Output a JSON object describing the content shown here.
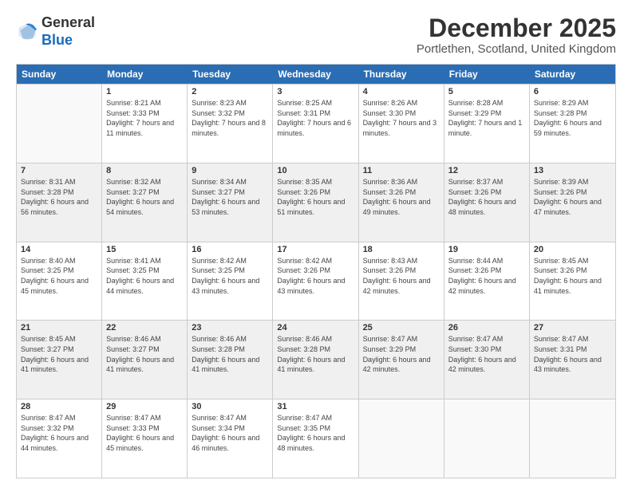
{
  "header": {
    "logo_general": "General",
    "logo_blue": "Blue",
    "month_year": "December 2025",
    "location": "Portlethen, Scotland, United Kingdom"
  },
  "weekdays": [
    "Sunday",
    "Monday",
    "Tuesday",
    "Wednesday",
    "Thursday",
    "Friday",
    "Saturday"
  ],
  "weeks": [
    [
      {
        "day": "",
        "sunrise": "",
        "sunset": "",
        "daylight": ""
      },
      {
        "day": "1",
        "sunrise": "Sunrise: 8:21 AM",
        "sunset": "Sunset: 3:33 PM",
        "daylight": "Daylight: 7 hours and 11 minutes."
      },
      {
        "day": "2",
        "sunrise": "Sunrise: 8:23 AM",
        "sunset": "Sunset: 3:32 PM",
        "daylight": "Daylight: 7 hours and 8 minutes."
      },
      {
        "day": "3",
        "sunrise": "Sunrise: 8:25 AM",
        "sunset": "Sunset: 3:31 PM",
        "daylight": "Daylight: 7 hours and 6 minutes."
      },
      {
        "day": "4",
        "sunrise": "Sunrise: 8:26 AM",
        "sunset": "Sunset: 3:30 PM",
        "daylight": "Daylight: 7 hours and 3 minutes."
      },
      {
        "day": "5",
        "sunrise": "Sunrise: 8:28 AM",
        "sunset": "Sunset: 3:29 PM",
        "daylight": "Daylight: 7 hours and 1 minute."
      },
      {
        "day": "6",
        "sunrise": "Sunrise: 8:29 AM",
        "sunset": "Sunset: 3:28 PM",
        "daylight": "Daylight: 6 hours and 59 minutes."
      }
    ],
    [
      {
        "day": "7",
        "sunrise": "Sunrise: 8:31 AM",
        "sunset": "Sunset: 3:28 PM",
        "daylight": "Daylight: 6 hours and 56 minutes."
      },
      {
        "day": "8",
        "sunrise": "Sunrise: 8:32 AM",
        "sunset": "Sunset: 3:27 PM",
        "daylight": "Daylight: 6 hours and 54 minutes."
      },
      {
        "day": "9",
        "sunrise": "Sunrise: 8:34 AM",
        "sunset": "Sunset: 3:27 PM",
        "daylight": "Daylight: 6 hours and 53 minutes."
      },
      {
        "day": "10",
        "sunrise": "Sunrise: 8:35 AM",
        "sunset": "Sunset: 3:26 PM",
        "daylight": "Daylight: 6 hours and 51 minutes."
      },
      {
        "day": "11",
        "sunrise": "Sunrise: 8:36 AM",
        "sunset": "Sunset: 3:26 PM",
        "daylight": "Daylight: 6 hours and 49 minutes."
      },
      {
        "day": "12",
        "sunrise": "Sunrise: 8:37 AM",
        "sunset": "Sunset: 3:26 PM",
        "daylight": "Daylight: 6 hours and 48 minutes."
      },
      {
        "day": "13",
        "sunrise": "Sunrise: 8:39 AM",
        "sunset": "Sunset: 3:26 PM",
        "daylight": "Daylight: 6 hours and 47 minutes."
      }
    ],
    [
      {
        "day": "14",
        "sunrise": "Sunrise: 8:40 AM",
        "sunset": "Sunset: 3:25 PM",
        "daylight": "Daylight: 6 hours and 45 minutes."
      },
      {
        "day": "15",
        "sunrise": "Sunrise: 8:41 AM",
        "sunset": "Sunset: 3:25 PM",
        "daylight": "Daylight: 6 hours and 44 minutes."
      },
      {
        "day": "16",
        "sunrise": "Sunrise: 8:42 AM",
        "sunset": "Sunset: 3:25 PM",
        "daylight": "Daylight: 6 hours and 43 minutes."
      },
      {
        "day": "17",
        "sunrise": "Sunrise: 8:42 AM",
        "sunset": "Sunset: 3:26 PM",
        "daylight": "Daylight: 6 hours and 43 minutes."
      },
      {
        "day": "18",
        "sunrise": "Sunrise: 8:43 AM",
        "sunset": "Sunset: 3:26 PM",
        "daylight": "Daylight: 6 hours and 42 minutes."
      },
      {
        "day": "19",
        "sunrise": "Sunrise: 8:44 AM",
        "sunset": "Sunset: 3:26 PM",
        "daylight": "Daylight: 6 hours and 42 minutes."
      },
      {
        "day": "20",
        "sunrise": "Sunrise: 8:45 AM",
        "sunset": "Sunset: 3:26 PM",
        "daylight": "Daylight: 6 hours and 41 minutes."
      }
    ],
    [
      {
        "day": "21",
        "sunrise": "Sunrise: 8:45 AM",
        "sunset": "Sunset: 3:27 PM",
        "daylight": "Daylight: 6 hours and 41 minutes."
      },
      {
        "day": "22",
        "sunrise": "Sunrise: 8:46 AM",
        "sunset": "Sunset: 3:27 PM",
        "daylight": "Daylight: 6 hours and 41 minutes."
      },
      {
        "day": "23",
        "sunrise": "Sunrise: 8:46 AM",
        "sunset": "Sunset: 3:28 PM",
        "daylight": "Daylight: 6 hours and 41 minutes."
      },
      {
        "day": "24",
        "sunrise": "Sunrise: 8:46 AM",
        "sunset": "Sunset: 3:28 PM",
        "daylight": "Daylight: 6 hours and 41 minutes."
      },
      {
        "day": "25",
        "sunrise": "Sunrise: 8:47 AM",
        "sunset": "Sunset: 3:29 PM",
        "daylight": "Daylight: 6 hours and 42 minutes."
      },
      {
        "day": "26",
        "sunrise": "Sunrise: 8:47 AM",
        "sunset": "Sunset: 3:30 PM",
        "daylight": "Daylight: 6 hours and 42 minutes."
      },
      {
        "day": "27",
        "sunrise": "Sunrise: 8:47 AM",
        "sunset": "Sunset: 3:31 PM",
        "daylight": "Daylight: 6 hours and 43 minutes."
      }
    ],
    [
      {
        "day": "28",
        "sunrise": "Sunrise: 8:47 AM",
        "sunset": "Sunset: 3:32 PM",
        "daylight": "Daylight: 6 hours and 44 minutes."
      },
      {
        "day": "29",
        "sunrise": "Sunrise: 8:47 AM",
        "sunset": "Sunset: 3:33 PM",
        "daylight": "Daylight: 6 hours and 45 minutes."
      },
      {
        "day": "30",
        "sunrise": "Sunrise: 8:47 AM",
        "sunset": "Sunset: 3:34 PM",
        "daylight": "Daylight: 6 hours and 46 minutes."
      },
      {
        "day": "31",
        "sunrise": "Sunrise: 8:47 AM",
        "sunset": "Sunset: 3:35 PM",
        "daylight": "Daylight: 6 hours and 48 minutes."
      },
      {
        "day": "",
        "sunrise": "",
        "sunset": "",
        "daylight": ""
      },
      {
        "day": "",
        "sunrise": "",
        "sunset": "",
        "daylight": ""
      },
      {
        "day": "",
        "sunrise": "",
        "sunset": "",
        "daylight": ""
      }
    ]
  ]
}
